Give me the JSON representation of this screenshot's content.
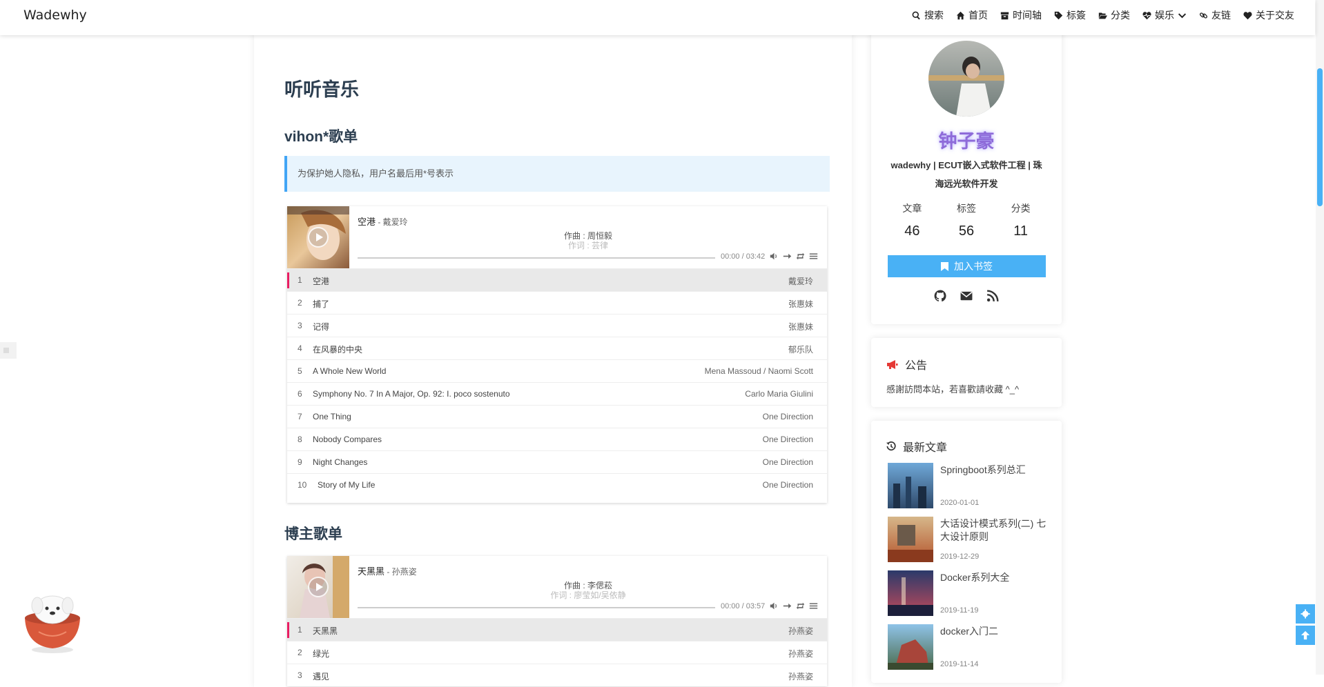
{
  "site": {
    "brand": "Wadewhy"
  },
  "nav": [
    {
      "label": "搜索",
      "icon": "search-icon"
    },
    {
      "label": "首页",
      "icon": "home-icon"
    },
    {
      "label": "时间轴",
      "icon": "archive-icon"
    },
    {
      "label": "标簽",
      "icon": "tags-icon"
    },
    {
      "label": "分类",
      "icon": "folder-open-icon"
    },
    {
      "label": "娱乐",
      "icon": "heartbeat-icon"
    },
    {
      "label": "友链",
      "icon": "link-icon"
    },
    {
      "label": "关于交友",
      "icon": "heart-icon"
    }
  ],
  "main": {
    "title": "听听音乐",
    "section1": "vihon*歌单",
    "notice": "为保护她人隐私，用户名最后用*号表示",
    "section2": "博主歌单"
  },
  "player1": {
    "song": "空港",
    "artist": " - 戴爱玲",
    "lrc_line1": "作曲 : 周恒毅",
    "lrc_line2": "作词 : 芸律",
    "time": "00:00 / 03:42",
    "progress": 0,
    "tracks": [
      {
        "idx": "1",
        "name": "空港",
        "artist": "戴爱玲"
      },
      {
        "idx": "2",
        "name": "捕了",
        "artist": "张惠妹"
      },
      {
        "idx": "3",
        "name": "记得",
        "artist": "张惠妹"
      },
      {
        "idx": "4",
        "name": "在风暴的中央",
        "artist": "郁乐队"
      },
      {
        "idx": "5",
        "name": "A Whole New World",
        "artist": "Mena Massoud / Naomi Scott"
      },
      {
        "idx": "6",
        "name": "Symphony No. 7 In A Major, Op. 92: I. poco sostenuto",
        "artist": "Carlo Maria Giulini"
      },
      {
        "idx": "7",
        "name": "One Thing",
        "artist": "One Direction"
      },
      {
        "idx": "8",
        "name": "Nobody Compares",
        "artist": "One Direction"
      },
      {
        "idx": "9",
        "name": "Night Changes",
        "artist": "One Direction"
      },
      {
        "idx": "10",
        "name": "Story of My Life",
        "artist": "One Direction"
      }
    ]
  },
  "player2": {
    "song": "天黑黑",
    "artist": " - 孙燕姿",
    "lrc_line1": "作曲 : 李偲菘",
    "lrc_line2": "作词 : 廖莹如/吴依静",
    "time": "00:00 / 03:57",
    "progress": 0,
    "tracks": [
      {
        "idx": "1",
        "name": "天黑黑",
        "artist": "孙燕姿"
      },
      {
        "idx": "2",
        "name": "绿光",
        "artist": "孙燕姿"
      },
      {
        "idx": "3",
        "name": "遇见",
        "artist": "孙燕姿"
      }
    ]
  },
  "profile": {
    "name": "钟子豪",
    "bio": "wadewhy | ECUT嵌入式软件工程 | 珠海远光软件开发",
    "stats": [
      {
        "label": "文章",
        "value": "46"
      },
      {
        "label": "标签",
        "value": "56"
      },
      {
        "label": "分类",
        "value": "11"
      }
    ],
    "bookmark": "加入书签"
  },
  "announcement": {
    "title": "公告",
    "text": "感謝訪問本站，若喜歡請收藏 ^_^"
  },
  "recent": {
    "title": "最新文章",
    "posts": [
      {
        "title": "Springboot系列总汇",
        "date": "2020-01-01"
      },
      {
        "title": "大话设计模式系列(二) 七大设计原则",
        "date": "2019-12-29"
      },
      {
        "title": "Docker系列大全",
        "date": "2019-11-19"
      },
      {
        "title": "docker入门二",
        "date": "2019-11-14"
      }
    ]
  },
  "colors": {
    "accent": "#49b1f5",
    "active_track": "#e91e63",
    "heading": "#2c3e50",
    "author": "#8e6bd9"
  }
}
